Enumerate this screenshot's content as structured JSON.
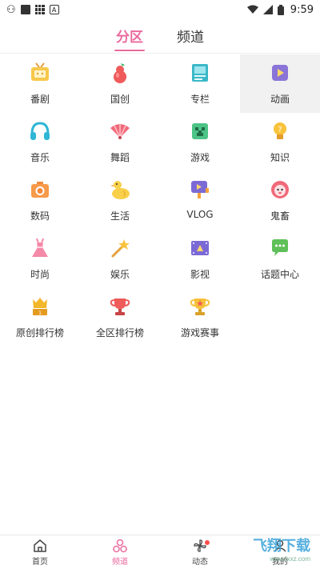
{
  "statusbar": {
    "time": "9:59",
    "letter": "A"
  },
  "tabs": [
    {
      "label": "分区"
    },
    {
      "label": "频道"
    }
  ],
  "categories": [
    {
      "label": "番剧",
      "icon": "tv-icon"
    },
    {
      "label": "国创",
      "icon": "gourd-icon"
    },
    {
      "label": "专栏",
      "icon": "article-icon"
    },
    {
      "label": "动画",
      "icon": "play-card-icon"
    },
    {
      "label": "音乐",
      "icon": "headphones-icon"
    },
    {
      "label": "舞蹈",
      "icon": "fan-icon"
    },
    {
      "label": "游戏",
      "icon": "creeper-icon"
    },
    {
      "label": "知识",
      "icon": "lightbulb-icon"
    },
    {
      "label": "数码",
      "icon": "camera-icon"
    },
    {
      "label": "生活",
      "icon": "duck-icon"
    },
    {
      "label": "VLOG",
      "icon": "video-camera-icon"
    },
    {
      "label": "鬼畜",
      "icon": "ghost-face-icon"
    },
    {
      "label": "时尚",
      "icon": "dress-icon"
    },
    {
      "label": "娱乐",
      "icon": "magic-wand-icon"
    },
    {
      "label": "影视",
      "icon": "film-icon"
    },
    {
      "label": "话题中心",
      "icon": "chat-bubble-icon"
    },
    {
      "label": "原创排行榜",
      "icon": "crown-podium-icon"
    },
    {
      "label": "全区排行榜",
      "icon": "trophy-red-icon"
    },
    {
      "label": "游戏赛事",
      "icon": "trophy-gold-icon"
    }
  ],
  "bottom_nav": [
    {
      "label": "首页",
      "icon": "home-icon"
    },
    {
      "label": "频道",
      "icon": "channel-icon"
    },
    {
      "label": "动态",
      "icon": "pinwheel-icon"
    },
    {
      "label": "我的",
      "icon": "profile-icon"
    }
  ],
  "watermark": {
    "text": "飞翔下载",
    "sub": "www.fxxz.com"
  },
  "colors": {
    "accent": "#ea6a9e",
    "highlight_bg": "#f1f1f1"
  }
}
